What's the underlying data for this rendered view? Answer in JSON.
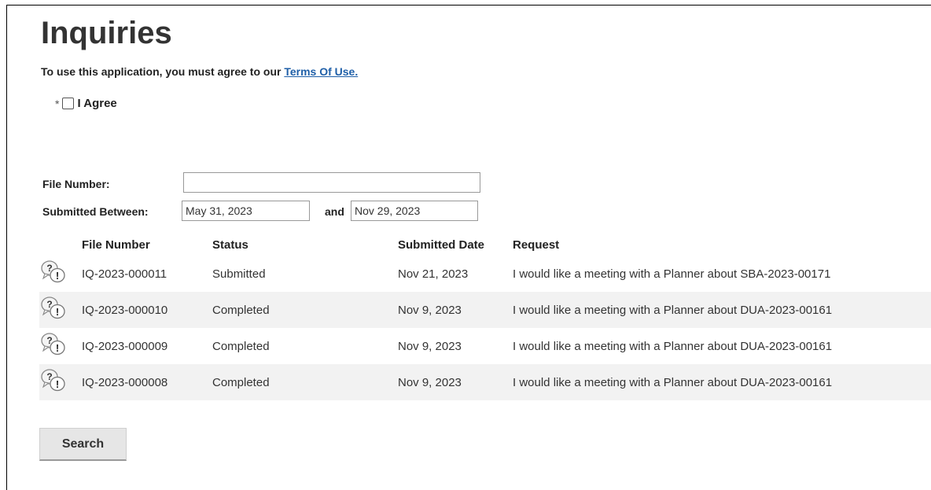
{
  "page": {
    "title": "Inquiries"
  },
  "terms": {
    "text": "To use this application, you must agree to our ",
    "link_label": "Terms Of Use.",
    "required_mark": "*",
    "agree_label": "I Agree"
  },
  "form": {
    "file_number_label": "File Number:",
    "file_number_value": "",
    "submitted_between_label": "Submitted Between:",
    "start_date_value": "May 31, 2023",
    "and_label": "and",
    "end_date_value": "Nov 29, 2023"
  },
  "table": {
    "headers": [
      "File Number",
      "Status",
      "Submitted Date",
      "Request"
    ],
    "rows": [
      {
        "file": "IQ-2023-000011",
        "status": "Submitted",
        "date": "Nov 21, 2023",
        "request": "I would like a meeting with a Planner about SBA-2023-00171"
      },
      {
        "file": "IQ-2023-000010",
        "status": "Completed",
        "date": "Nov 9, 2023",
        "request": "I would like a meeting with a Planner about DUA-2023-00161"
      },
      {
        "file": "IQ-2023-000009",
        "status": "Completed",
        "date": "Nov 9, 2023",
        "request": "I would like a meeting with a Planner about DUA-2023-00161"
      },
      {
        "file": "IQ-2023-000008",
        "status": "Completed",
        "date": "Nov 9, 2023",
        "request": "I would like a meeting with a Planner about DUA-2023-00161"
      }
    ]
  },
  "actions": {
    "search_label": "Search"
  },
  "icons": {
    "row_icon": "inquiry-speech-bubble-icon"
  }
}
